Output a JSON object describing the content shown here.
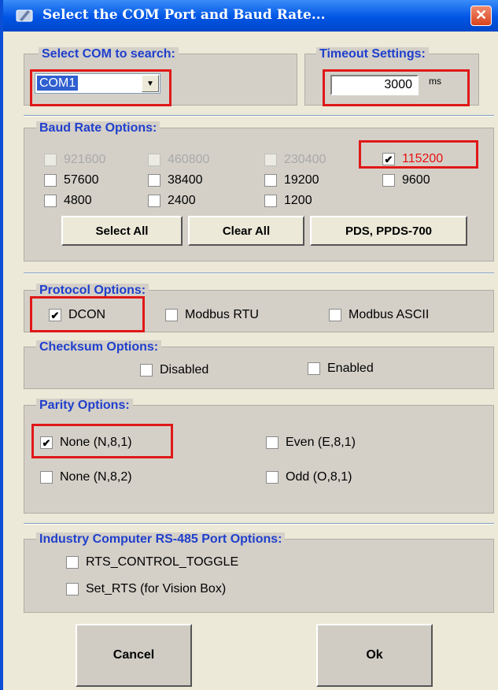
{
  "title": "Select the COM Port and Baud Rate...",
  "close_glyph": "✕",
  "com": {
    "legend": "Select COM to search:",
    "value": "COM1"
  },
  "timeout": {
    "legend": "Timeout Settings:",
    "value": "3000",
    "unit": "ms"
  },
  "baud": {
    "legend": "Baud Rate Options:",
    "rates": [
      {
        "label": "921600",
        "checked": false,
        "enabled": false
      },
      {
        "label": "460800",
        "checked": false,
        "enabled": false
      },
      {
        "label": "230400",
        "checked": false,
        "enabled": false
      },
      {
        "label": "115200",
        "checked": true,
        "enabled": true
      },
      {
        "label": "57600",
        "checked": false,
        "enabled": true
      },
      {
        "label": "38400",
        "checked": false,
        "enabled": true
      },
      {
        "label": "19200",
        "checked": false,
        "enabled": true
      },
      {
        "label": "9600",
        "checked": false,
        "enabled": true
      },
      {
        "label": "4800",
        "checked": false,
        "enabled": true
      },
      {
        "label": "2400",
        "checked": false,
        "enabled": true
      },
      {
        "label": "1200",
        "checked": false,
        "enabled": true
      }
    ],
    "select_all": "Select All",
    "clear_all": "Clear All",
    "pds": "PDS, PPDS-700"
  },
  "protocol": {
    "legend": "Protocol Options:",
    "options": [
      {
        "label": "DCON",
        "checked": true
      },
      {
        "label": "Modbus RTU",
        "checked": false
      },
      {
        "label": "Modbus ASCII",
        "checked": false
      }
    ]
  },
  "checksum": {
    "legend": "Checksum  Options:",
    "options": [
      {
        "label": "Disabled",
        "checked": false
      },
      {
        "label": "Enabled",
        "checked": false
      }
    ]
  },
  "parity": {
    "legend": "Parity Options:",
    "options": [
      {
        "label": "None (N,8,1)",
        "checked": true
      },
      {
        "label": "Even (E,8,1)",
        "checked": false
      },
      {
        "label": "None (N,8,2)",
        "checked": false
      },
      {
        "label": "Odd (O,8,1)",
        "checked": false
      }
    ]
  },
  "rs485": {
    "legend": "Industry Computer RS-485 Port Options:",
    "options": [
      {
        "label": "RTS_CONTROL_TOGGLE",
        "checked": false
      },
      {
        "label": "Set_RTS (for Vision Box)",
        "checked": false
      }
    ]
  },
  "buttons": {
    "cancel": "Cancel",
    "ok": "Ok"
  },
  "colors": {
    "titlebar": "#0055e5",
    "legend_text": "#1f3fcc",
    "highlight_red": "#e01818",
    "panel": "#d4d0c8"
  }
}
